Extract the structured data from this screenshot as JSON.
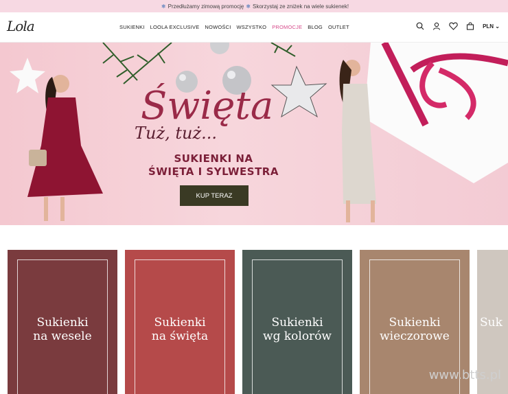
{
  "promo_bar": {
    "part1": "Przedłużamy zimową promocję",
    "part2": "Skorzystaj ze zniżek na wiele sukienek!",
    "icon": "snowflake-icon"
  },
  "header": {
    "logo": "Lola",
    "nav": [
      "SUKIENKI",
      "LOOLA EXCLUSIVE",
      "NOWOŚCI",
      "WSZYSTKO",
      "PROMOCJE",
      "BLOG",
      "OUTLET"
    ],
    "currency": "PLN",
    "colors": {
      "accent": "#d64a8a"
    }
  },
  "hero": {
    "headline": "Święta",
    "tagline": "Tuż, tuż...",
    "subtitle_1": "SUKIENKI NA",
    "subtitle_2": "ŚWIĘTA I SYLWESTRA",
    "cta": "KUP TERAZ"
  },
  "categories": [
    {
      "line1": "Sukienki",
      "line2": "na wesele",
      "bg": "#7a3b3e"
    },
    {
      "line1": "Sukienki",
      "line2": "na święta",
      "bg": "#b54a4a"
    },
    {
      "line1": "Sukienki",
      "line2": "wg kolorów",
      "bg": "#4b5a55"
    },
    {
      "line1": "Sukienki",
      "line2": "wieczorowe",
      "bg": "#a8866e"
    },
    {
      "line1": "Suk",
      "line2": "",
      "bg": "#cfc7bf"
    }
  ],
  "watermark": "www.btts.pl"
}
